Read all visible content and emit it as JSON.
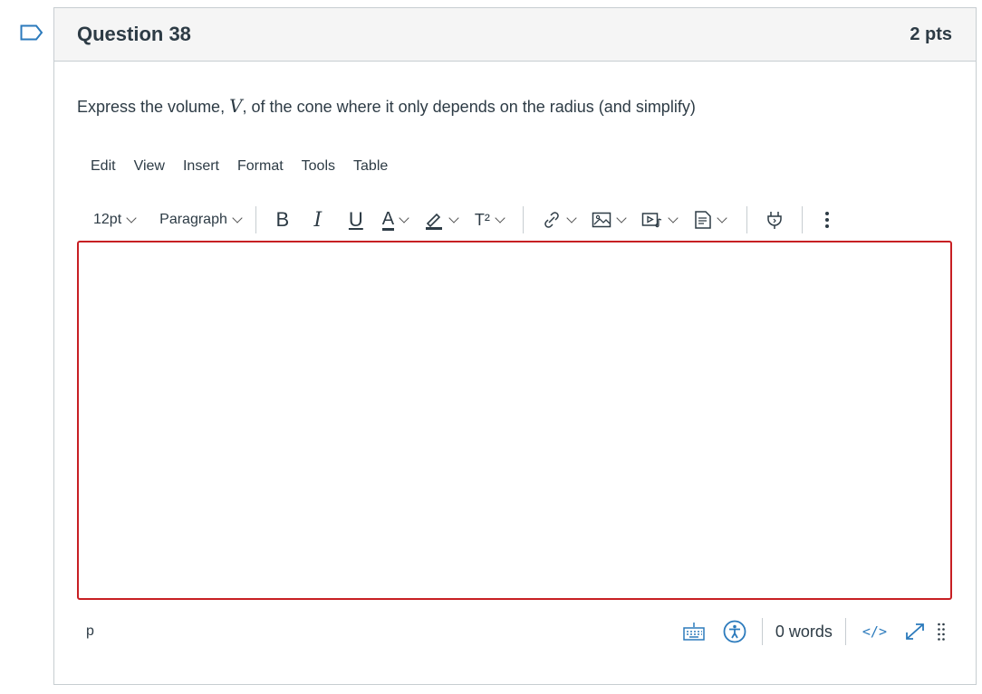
{
  "question": {
    "title": "Question 38",
    "points": "2 pts",
    "text_before": "Express the volume, ",
    "variable": "V",
    "text_after": ", of the cone where it only depends on the radius (and simplify)"
  },
  "menubar": {
    "items": [
      "Edit",
      "View",
      "Insert",
      "Format",
      "Tools",
      "Table"
    ]
  },
  "toolbar": {
    "font_size": "12pt",
    "block_format": "Paragraph",
    "bold_label": "B",
    "italic_label": "I",
    "underline_label": "U",
    "text_color_label": "A",
    "superscript_label": "T²",
    "icons": [
      "link-icon",
      "image-icon",
      "media-icon",
      "document-icon",
      "plugin-icon",
      "more-icon"
    ]
  },
  "editor": {
    "content": ""
  },
  "statusbar": {
    "path": "p",
    "word_count": "0 words",
    "html_toggle": "</>"
  },
  "colors": {
    "editor_border": "#c71f23",
    "link_blue": "#2b7abc",
    "text": "#2d3b45",
    "header_bg": "#f5f5f5"
  }
}
